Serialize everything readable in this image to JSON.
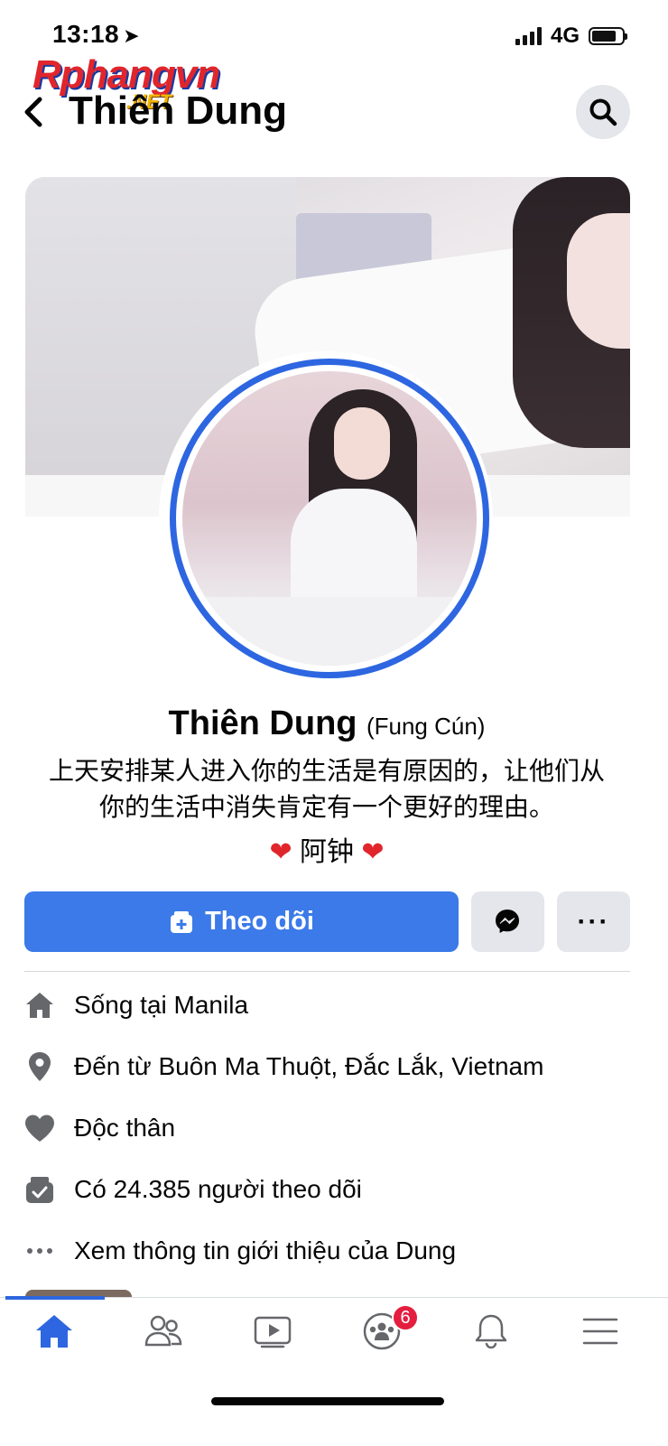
{
  "status_bar": {
    "time": "13:18",
    "network": "4G"
  },
  "watermark": {
    "brand": "Rphangvn",
    "suffix": ".NET"
  },
  "header": {
    "title": "Thiên Dung"
  },
  "profile": {
    "name": "Thiên Dung",
    "alt_name": "(Fung Cún)",
    "bio_line1": "上天安排某人进入你的生活是有原因的，让他们从",
    "bio_line2": "你的生活中消失肯定有一个更好的理由。",
    "bio_tag": "阿钟"
  },
  "actions": {
    "follow_label": "Theo dõi",
    "more_label": "···"
  },
  "info": [
    {
      "icon": "home-icon",
      "prefix": "Sống tại ",
      "value": "Manila"
    },
    {
      "icon": "location-pin-icon",
      "prefix": "Đến từ ",
      "value": "Buôn Ma Thuột, Đắc Lắk, Vietnam"
    },
    {
      "icon": "heart-icon",
      "prefix": "",
      "value": "Độc thân"
    },
    {
      "icon": "followers-icon",
      "prefix": "",
      "value": "Có 24.385 người theo dõi"
    },
    {
      "icon": "more-dots-icon",
      "prefix": "",
      "value": "Xem thông tin giới thiệu của Dung"
    }
  ],
  "nav": {
    "groups_badge": "6"
  },
  "colors": {
    "accent": "#3b7ae8",
    "badge": "#e41e3f",
    "button_gray": "#e4e6eb"
  }
}
